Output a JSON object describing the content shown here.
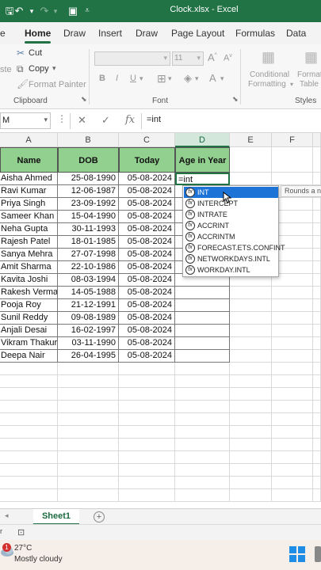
{
  "app": {
    "title": "Clock.xlsx  -  Excel",
    "accent": "#217346"
  },
  "titlebar": {
    "icons": [
      "save-icon",
      "undo-icon",
      "redo-icon",
      "form-icon",
      "quick-access-dropdown-icon"
    ]
  },
  "ribbon_tabs": [
    "e",
    "Home",
    "Draw",
    "Insert",
    "Draw",
    "Page Layout",
    "Formulas",
    "Data"
  ],
  "ribbon": {
    "clipboard": {
      "cut": "Cut",
      "copy": "Copy",
      "format_painter": "Format Painter",
      "paste_partial": "ste",
      "group_label": "Clipboard"
    },
    "font": {
      "size": "11",
      "bold": "B",
      "italic": "I",
      "underline": "U",
      "group_label": "Font"
    },
    "styles": {
      "conditional_1": "Conditional",
      "conditional_2": "Formatting",
      "format_table_1": "Format",
      "format_table_2": "Table",
      "group_label": "Styles"
    }
  },
  "formula_bar": {
    "name_box": "M",
    "cancel": "✕",
    "enter": "✓",
    "fx": "fx",
    "formula": "=int"
  },
  "columns": [
    "A",
    "B",
    "C",
    "D",
    "E",
    "F"
  ],
  "table": {
    "headers": [
      "Name",
      "DOB",
      "Today",
      "Age in Year"
    ],
    "rows": [
      {
        "name": "Aisha Ahmed",
        "dob": "25-08-1990",
        "today": "05-08-2024",
        "age": "=int"
      },
      {
        "name": "Ravi Kumar",
        "dob": "12-06-1987",
        "today": "05-08-2024",
        "age": ""
      },
      {
        "name": "Priya Singh",
        "dob": "23-09-1992",
        "today": "05-08-2024",
        "age": ""
      },
      {
        "name": "Sameer Khan",
        "dob": "15-04-1990",
        "today": "05-08-2024",
        "age": ""
      },
      {
        "name": "Neha Gupta",
        "dob": "30-11-1993",
        "today": "05-08-2024",
        "age": ""
      },
      {
        "name": "Rajesh Patel",
        "dob": "18-01-1985",
        "today": "05-08-2024",
        "age": ""
      },
      {
        "name": "Sanya Mehra",
        "dob": "27-07-1998",
        "today": "05-08-2024",
        "age": ""
      },
      {
        "name": "Amit Sharma",
        "dob": "22-10-1986",
        "today": "05-08-2024",
        "age": ""
      },
      {
        "name": "Kavita Joshi",
        "dob": "08-03-1994",
        "today": "05-08-2024",
        "age": ""
      },
      {
        "name": "Rakesh Verma",
        "dob": "14-05-1988",
        "today": "05-08-2024",
        "age": ""
      },
      {
        "name": "Pooja Roy",
        "dob": "21-12-1991",
        "today": "05-08-2024",
        "age": ""
      },
      {
        "name": "Sunil Reddy",
        "dob": "09-08-1989",
        "today": "05-08-2024",
        "age": ""
      },
      {
        "name": "Anjali Desai",
        "dob": "16-02-1997",
        "today": "05-08-2024",
        "age": ""
      },
      {
        "name": "Vikram Thakur",
        "dob": "03-11-1990",
        "today": "05-08-2024",
        "age": ""
      },
      {
        "name": "Deepa Nair",
        "dob": "26-04-1995",
        "today": "05-08-2024",
        "age": ""
      }
    ]
  },
  "autocomplete": {
    "items": [
      "INT",
      "INTERCEPT",
      "INTRATE",
      "ACCRINT",
      "ACCRINTM",
      "FORECAST.ETS.CONFINT",
      "NETWORKDAYS.INTL",
      "WORKDAY.INTL"
    ],
    "selected": 0,
    "tooltip": "Rounds a n"
  },
  "sheets": {
    "active": "Sheet1",
    "add": "+"
  },
  "taskbar": {
    "badge": "1",
    "temperature": "27°C",
    "weather": "Mostly cloudy"
  }
}
